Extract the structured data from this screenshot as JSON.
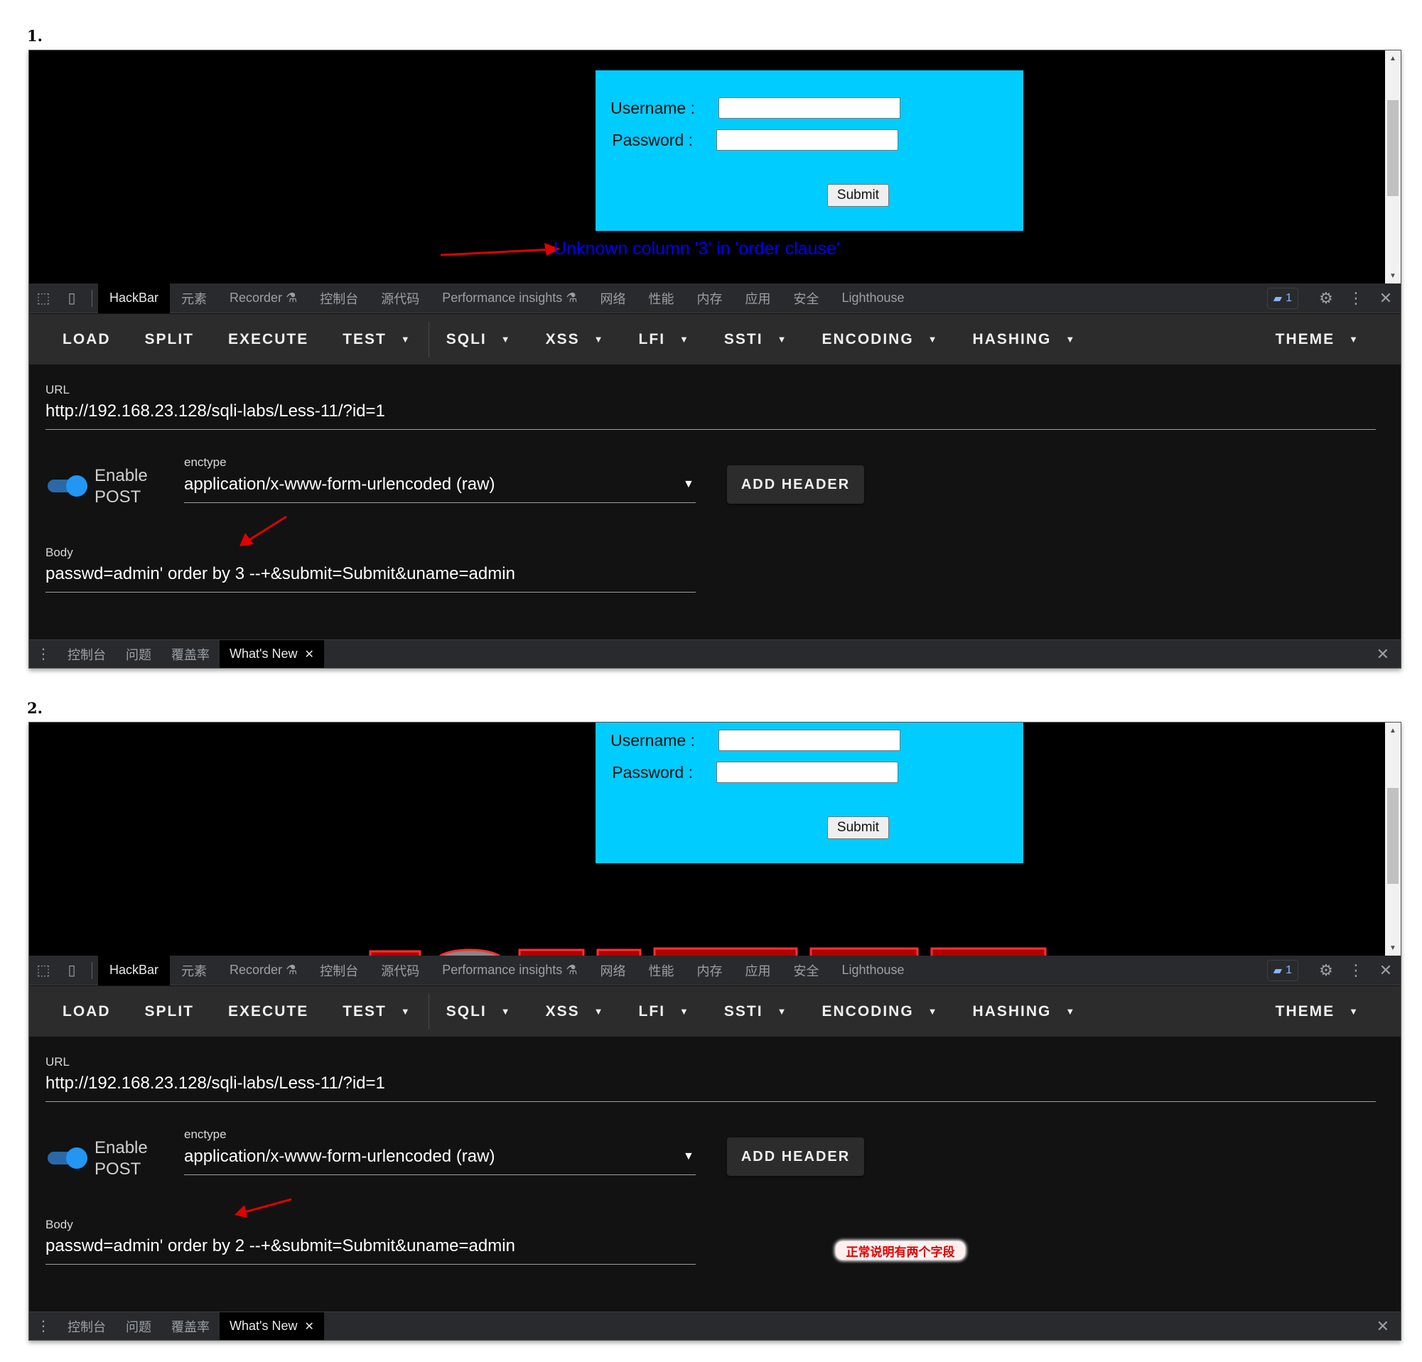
{
  "panels": [
    {
      "step_label": "1.",
      "login": {
        "username_label": "Username :",
        "password_label": "Password :",
        "submit_label": "Submit"
      },
      "error_message": "Unknown column '3' in 'order clause'",
      "devtools_tabs": [
        "HackBar",
        "元素",
        "Recorder",
        "控制台",
        "源代码",
        "Performance insights",
        "网络",
        "性能",
        "内存",
        "应用",
        "安全",
        "Lighthouse"
      ],
      "issues_count": "1",
      "hackbar": {
        "buttons": [
          "LOAD",
          "SPLIT",
          "EXECUTE"
        ],
        "dropdowns": [
          "TEST",
          "SQLI",
          "XSS",
          "LFI",
          "SSTI",
          "ENCODING",
          "HASHING"
        ],
        "theme_label": "THEME",
        "url_label": "URL",
        "url_value": "http://192.168.23.128/sqli-labs/Less-11/?id=1",
        "enable_label": "Enable",
        "post_label": "POST",
        "enctype_label": "enctype",
        "enctype_value": "application/x-www-form-urlencoded (raw)",
        "add_header_label": "ADD HEADER",
        "body_label": "Body",
        "body_value": "passwd=admin' order by 3 --+&submit=Submit&uname=admin"
      },
      "drawer_tabs": [
        "控制台",
        "问题",
        "覆盖率",
        "What's New"
      ]
    },
    {
      "step_label": "2.",
      "login": {
        "username_label": "Username :",
        "password_label": "Password :",
        "submit_label": "Submit"
      },
      "devtools_tabs": [
        "HackBar",
        "元素",
        "Recorder",
        "控制台",
        "源代码",
        "Performance insights",
        "网络",
        "性能",
        "内存",
        "应用",
        "安全",
        "Lighthouse"
      ],
      "issues_count": "1",
      "hackbar": {
        "buttons": [
          "LOAD",
          "SPLIT",
          "EXECUTE"
        ],
        "dropdowns": [
          "TEST",
          "SQLI",
          "XSS",
          "LFI",
          "SSTI",
          "ENCODING",
          "HASHING"
        ],
        "theme_label": "THEME",
        "url_label": "URL",
        "url_value": "http://192.168.23.128/sqli-labs/Less-11/?id=1",
        "enable_label": "Enable",
        "post_label": "POST",
        "enctype_label": "enctype",
        "enctype_value": "application/x-www-form-urlencoded (raw)",
        "add_header_label": "ADD HEADER",
        "body_label": "Body",
        "body_value": "passwd=admin' order by 2 --+&submit=Submit&uname=admin"
      },
      "annotation": "正常说明有两个字段",
      "drawer_tabs": [
        "控制台",
        "问题",
        "覆盖率",
        "What's New"
      ]
    }
  ],
  "colors": {
    "login_background": "#00ccff",
    "error_text": "#0000ff",
    "annotation_arrow": "#e00000",
    "toggle_on": "#2196f3",
    "toolbar_background": "#2c2c2c",
    "content_background": "#121212"
  },
  "icons": [
    "inspect-element-icon",
    "device-toolbar-icon",
    "flask-icon",
    "issues-icon",
    "gear-icon",
    "kebab-menu-icon",
    "close-icon",
    "caret-down-icon",
    "scroll-up-icon",
    "scroll-down-icon"
  ]
}
